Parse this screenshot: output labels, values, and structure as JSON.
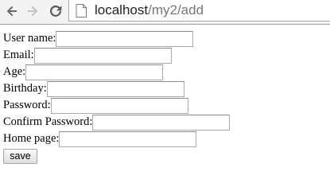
{
  "browser": {
    "url_host": "localhost",
    "url_path": "/my2/add",
    "icons": [
      "back-arrow-icon",
      "forward-arrow-icon",
      "reload-icon",
      "page-icon"
    ]
  },
  "form": {
    "fields": [
      {
        "label": "User name:",
        "value": ""
      },
      {
        "label": "Email:",
        "value": ""
      },
      {
        "label": "Age:",
        "value": ""
      },
      {
        "label": "Birthday:",
        "value": ""
      },
      {
        "label": "Password:",
        "value": ""
      },
      {
        "label": "Confirm Password:",
        "value": ""
      },
      {
        "label": "Home page:",
        "value": ""
      }
    ],
    "save_label": "save"
  }
}
